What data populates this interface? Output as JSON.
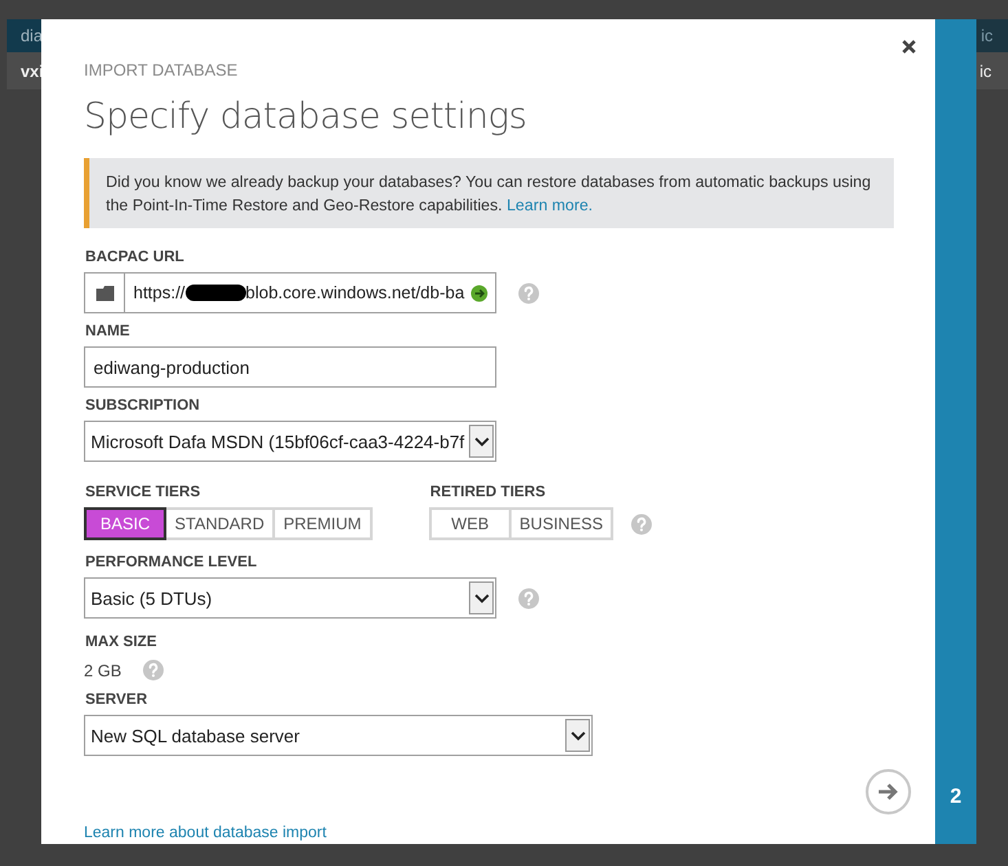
{
  "background": {
    "header_left": "dia",
    "header_right": "ic",
    "row_left": "vxi",
    "row_right": "ic"
  },
  "dialog": {
    "subtitle": "IMPORT DATABASE",
    "title": "Specify database settings",
    "notice": {
      "text": "Did you know we already backup your databases? You can restore databases from automatic backups using the Point-In-Time Restore and Geo-Restore capabilities.",
      "link": "Learn more."
    },
    "url": {
      "label": "BACPAC URL",
      "value": "https://",
      "value_after_redaction": "blob.core.windows.net/db-ba",
      "help": true
    },
    "name": {
      "label": "NAME",
      "value": "ediwang-production"
    },
    "subscription": {
      "label": "SUBSCRIPTION",
      "value": "Microsoft Dafa MSDN (15bf06cf-caa3-4224-b7f"
    },
    "tiers": [
      {
        "label": "SERVICE TIERS",
        "help": false,
        "options": [
          {
            "label": "BASIC",
            "selected": true
          },
          {
            "label": "STANDARD",
            "selected": false
          },
          {
            "label": "PREMIUM",
            "selected": false
          }
        ]
      },
      {
        "label": "RETIRED TIERS",
        "help": true,
        "options": [
          {
            "label": "WEB",
            "selected": false
          },
          {
            "label": "BUSINESS",
            "selected": false
          }
        ]
      }
    ],
    "performance": {
      "label": "PERFORMANCE LEVEL",
      "value": "Basic (5 DTUs)",
      "help": true
    },
    "max_size": {
      "label": "MAX SIZE",
      "value": "2 GB",
      "help": true
    },
    "server": {
      "label": "SERVER",
      "value": "New SQL database server"
    },
    "link": "Learn more about database import",
    "step": "2"
  }
}
